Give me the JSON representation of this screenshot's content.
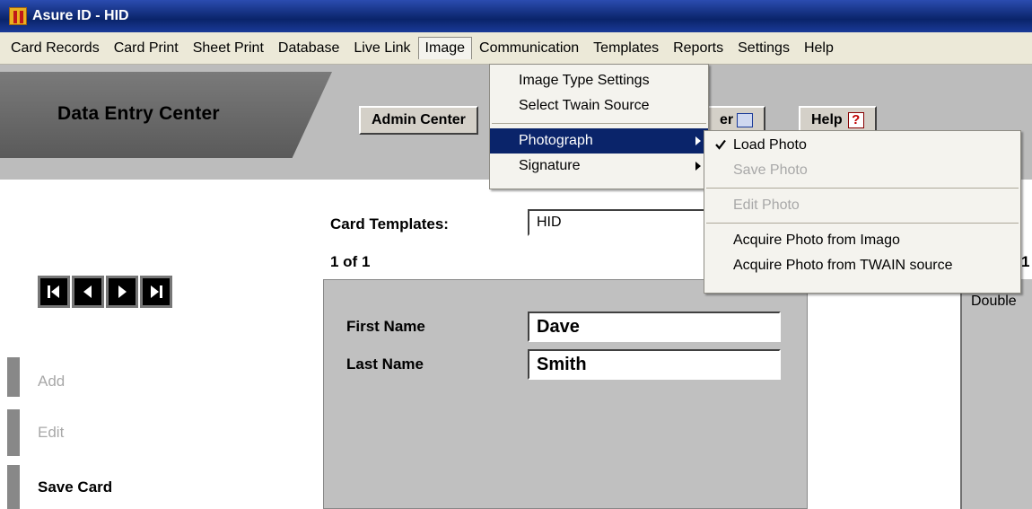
{
  "window": {
    "title": "Asure ID - HID"
  },
  "menubar": [
    "Card Records",
    "Card Print",
    "Sheet Print",
    "Database",
    "Live Link",
    "Image",
    "Communication",
    "Templates",
    "Reports",
    "Settings",
    "Help"
  ],
  "header": {
    "title": "Data Entry Center",
    "admin_button": "Admin Center",
    "exit_button_partial": "er",
    "help_button": "Help"
  },
  "image_menu": {
    "items": [
      "Image Type Settings",
      "Select Twain Source",
      "Photograph",
      "Signature"
    ]
  },
  "photograph_submenu": {
    "items": [
      {
        "label": "Load Photo",
        "checked": true,
        "enabled": true
      },
      {
        "label": "Save Photo",
        "enabled": false
      },
      {
        "label": "Edit Photo",
        "enabled": false
      },
      {
        "label": "Acquire Photo from Imago",
        "enabled": true
      },
      {
        "label": "Acquire Photo from TWAIN source",
        "enabled": true
      }
    ]
  },
  "form": {
    "templates_label": "Card Templates:",
    "template_value": "HID",
    "record_counter": "1 of 1",
    "right_counter_partial": "1",
    "right_panel_partial": "Double",
    "first_name_label": "First Name",
    "first_name_value": "Dave",
    "last_name_label": "Last Name",
    "last_name_value": "Smith"
  },
  "side": {
    "add": "Add",
    "edit": "Edit",
    "save": "Save Card"
  },
  "icons": [
    "first-record-icon",
    "previous-record-icon",
    "next-record-icon",
    "last-record-icon",
    "help-question-icon",
    "exit-icon",
    "app-logo-icon",
    "checkmark-icon",
    "submenu-arrow-icon"
  ]
}
